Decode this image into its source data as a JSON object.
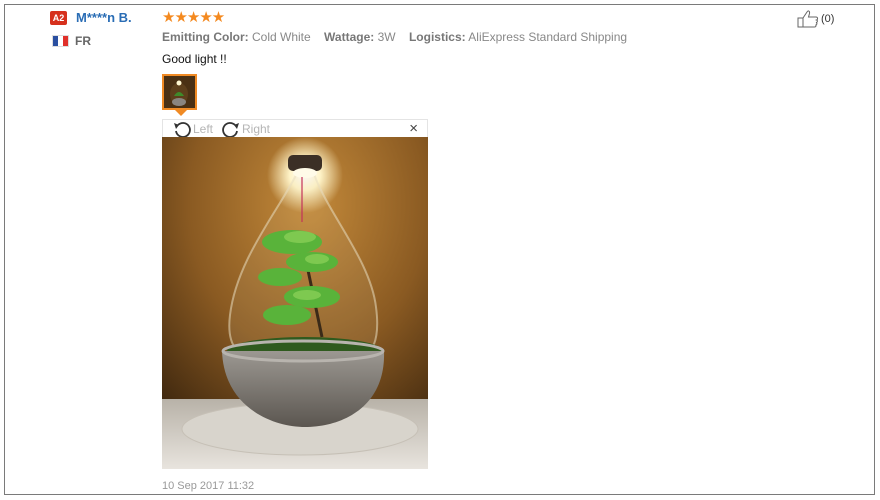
{
  "reviewer": {
    "level_badge": "A2",
    "name": "M****n B.",
    "country": "FR",
    "flag_colors": [
      "#2a4fa0",
      "#ffffff",
      "#e0302a"
    ]
  },
  "review": {
    "stars": "★★★★★",
    "rating": 5,
    "attributes": [
      {
        "label": "Emitting Color:",
        "value": "Cold White"
      },
      {
        "label": "Wattage:",
        "value": "3W"
      },
      {
        "label": "Logistics:",
        "value": "AliExpress Standard Shipping"
      }
    ],
    "text": "Good light !!",
    "timestamp": "10 Sep 2017 11:32"
  },
  "viewer": {
    "rotate_left_label": "Left",
    "rotate_right_label": "Right",
    "close_symbol": "×"
  },
  "helpful": {
    "count_label": "(0)"
  },
  "colors": {
    "accent": "#f08a24",
    "link": "#2a6db5",
    "badge": "#d6301d"
  }
}
